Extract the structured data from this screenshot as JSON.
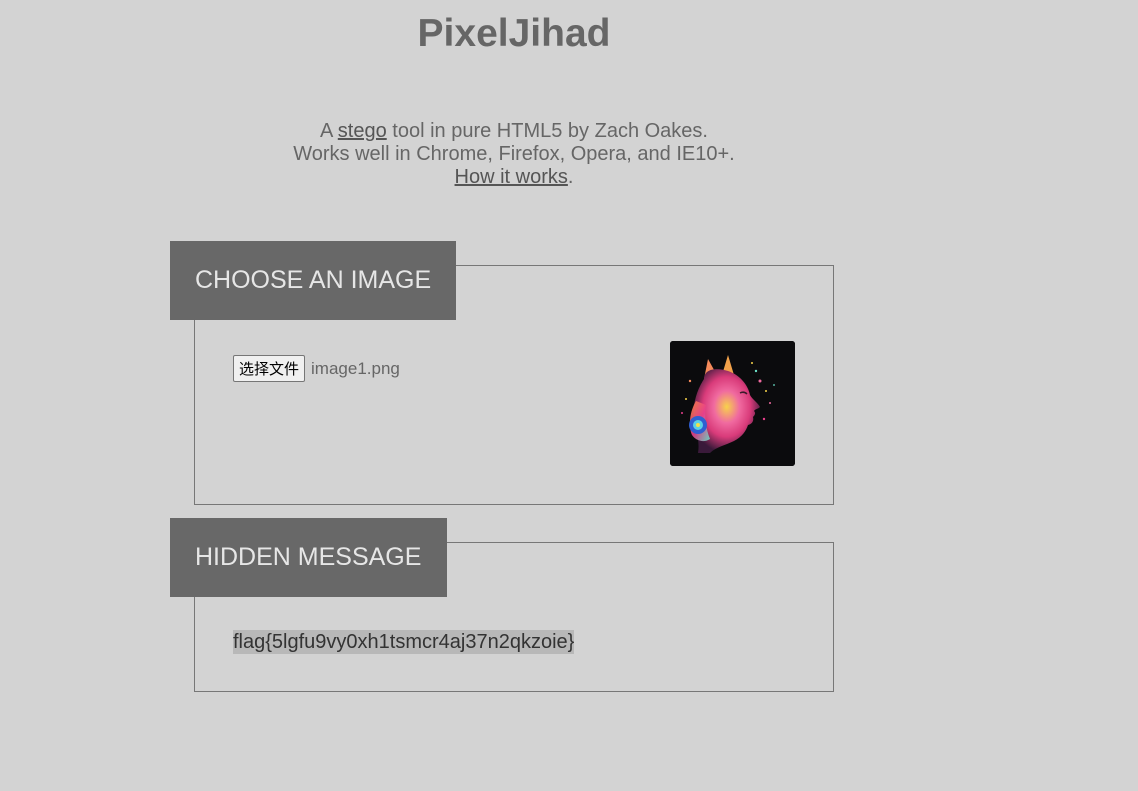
{
  "app": {
    "title": "PixelJihad"
  },
  "intro": {
    "line1_prefix": "A ",
    "line1_link": "stego",
    "line1_suffix": " tool in pure HTML5 by Zach Oakes.",
    "line2": "Works well in Chrome, Firefox, Opera, and IE10+.",
    "line3_link": "How it works",
    "line3_suffix": "."
  },
  "choose_image": {
    "header": "CHOOSE AN IMAGE",
    "file_button_label": "选择文件",
    "file_name": "image1.png",
    "thumbnail_icon": "colorful-portrait-image"
  },
  "hidden_message": {
    "header": "HIDDEN MESSAGE",
    "text": "flag{5lgfu9vy0xh1tsmcr4aj37n2qkzoie}"
  },
  "colors": {
    "background": "#d3d3d3",
    "header_bg": "#686868",
    "header_text": "#e6e6e6",
    "text": "#666666",
    "selection": "#b8b8b8"
  }
}
